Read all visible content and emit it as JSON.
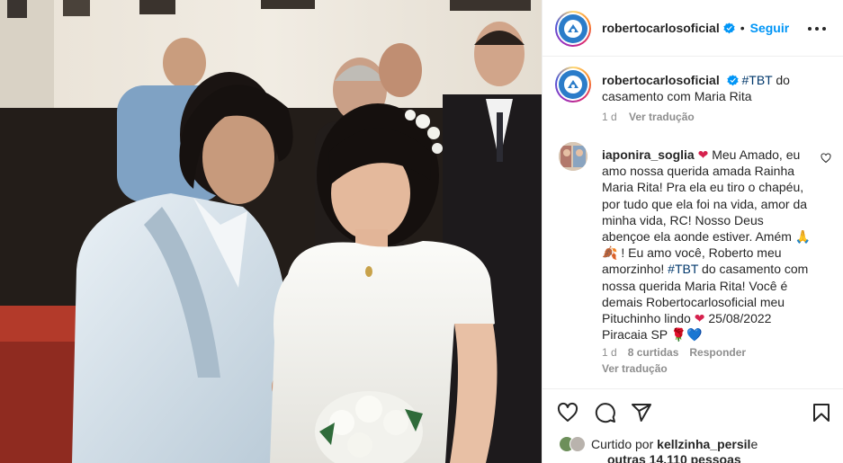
{
  "post": {
    "username": "robertocarlosoficial",
    "follow_label": "Seguir",
    "dot": "•"
  },
  "caption": {
    "username": "robertocarlosoficial",
    "hashtag": "#TBT",
    "text": " do casamento com Maria Rita",
    "age": "1 d",
    "translate": "Ver tradução"
  },
  "comment": {
    "username": "iaponira_soglia",
    "emoji1": "❤",
    "text1": " Meu Amado, eu amo nossa querida amada Rainha Maria Rita! Pra ela eu tiro o chapéu, por tudo que ela foi na vida, amor da minha vida, RC! Nosso Deus abençoe ela aonde estiver. Amém ",
    "emoji2": "🙏🍂",
    "text2": " ! Eu amo você, Roberto meu amorzinho! ",
    "hashtag": "#TBT",
    "text3": " do casamento com nossa querida Maria Rita! Você é demais Robertocarlosoficial meu Pituchinho lindo ",
    "emoji3": "❤",
    "text4": " 25/08/2022 Piracaia SP ",
    "emoji4": "🌹💙",
    "age": "1 d",
    "likes": "8 curtidas",
    "reply": "Responder",
    "translate": "Ver tradução"
  },
  "likes": {
    "prefix": "Curtido por ",
    "user": "kellzinha_persil",
    "suffix": " e",
    "others": "outras 14.110 pessoas"
  },
  "colors": {
    "accent": "#0095f6",
    "hashtag": "#00376b",
    "muted": "#8e8e8e",
    "heart": "#ed4956"
  },
  "icons": [
    "verified-badge-icon",
    "more-options-icon",
    "heart-icon",
    "comment-icon",
    "share-icon",
    "bookmark-icon"
  ]
}
